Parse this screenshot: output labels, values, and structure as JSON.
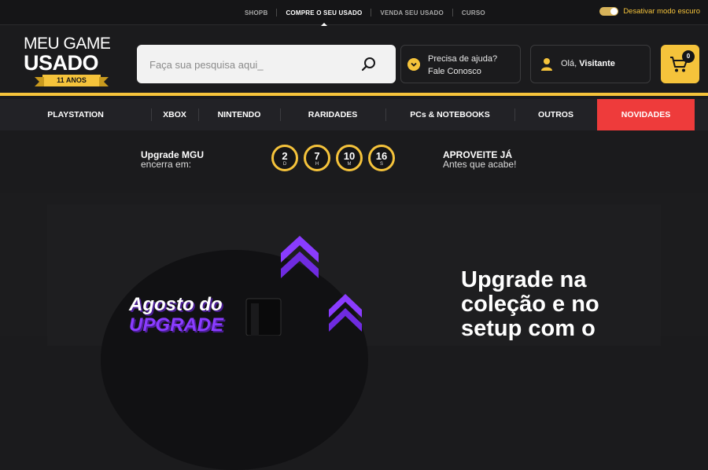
{
  "topbar": {
    "links": [
      "SHOPB",
      "COMPRE O SEU USADO",
      "VENDA SEU USADO",
      "CURSO"
    ],
    "dark_mode_label": "Desativar modo escuro"
  },
  "logo": {
    "line1": "MEU GAME",
    "line2": "USADO",
    "ribbon": "11 ANOS"
  },
  "search": {
    "placeholder": "Faça sua pesquisa aqui_"
  },
  "help": {
    "line1": "Precisa de ajuda?",
    "line2": "Fale Conosco"
  },
  "user": {
    "greeting": "Olá,",
    "name": "Visitante"
  },
  "cart": {
    "count": "0"
  },
  "nav": {
    "items": [
      "PLAYSTATION",
      "XBOX",
      "NINTENDO",
      "RARIDADES",
      "PCs & NOTEBOOKS",
      "OUTROS",
      "NOVIDADES"
    ]
  },
  "countdown": {
    "title": "Upgrade MGU",
    "subtitle": "encerra em:",
    "timers": [
      {
        "value": "2",
        "unit": "D"
      },
      {
        "value": "7",
        "unit": "H"
      },
      {
        "value": "10",
        "unit": "M"
      },
      {
        "value": "16",
        "unit": "S"
      }
    ],
    "cta_title": "APROVEITE JÁ",
    "cta_subtitle": "Antes que acabe!"
  },
  "banner": {
    "promo_line1": "Agosto do",
    "promo_line2": "UPGRADE",
    "headline": "Upgrade na coleção e no setup com o"
  },
  "colors": {
    "accent": "#f5c33b",
    "novidades": "#ee3b3b",
    "promo": "#8a3cff"
  }
}
